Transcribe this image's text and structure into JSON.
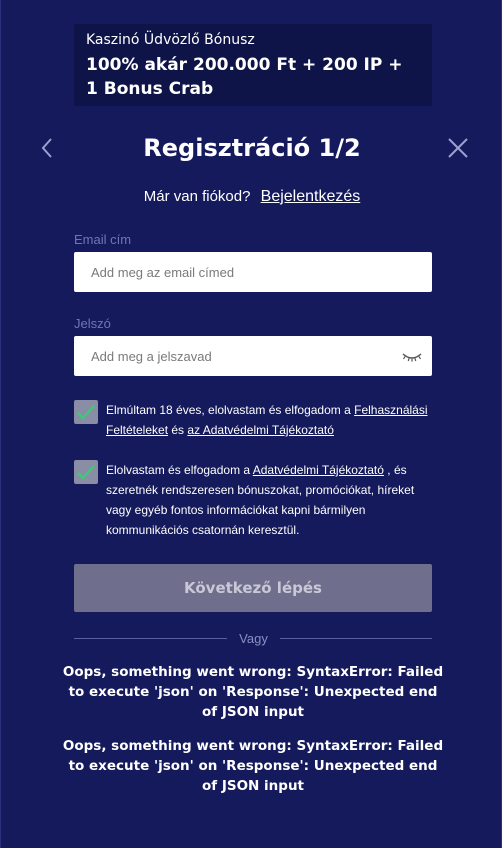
{
  "bonus": {
    "caption": "Kaszinó Üdvözlő Bónusz",
    "offer": "100% akár 200.000 Ft + 200 IP + 1 Bonus Crab"
  },
  "header": {
    "title": "Regisztráció 1/2",
    "back_icon": "chevron-left-icon",
    "close_icon": "close-icon"
  },
  "login": {
    "question": "Már van fiókod?",
    "link": "Bejelentkezés"
  },
  "email": {
    "label": "Email cím",
    "placeholder": "Add meg az email címed",
    "value": ""
  },
  "password": {
    "label": "Jelszó",
    "placeholder": "Add meg a jelszavad",
    "value": "",
    "toggle_icon": "eye-closed-icon"
  },
  "consents": [
    {
      "checked": true,
      "text_before": "Elmúltam 18 éves, elolvastam és elfogadom a ",
      "link1": "Felhasználási Feltételeket",
      "text_mid": " és ",
      "link2": "az Adatvédelmi Tájékoztató",
      "text_after": ""
    },
    {
      "checked": true,
      "text_before": "Elolvastam és elfogadom a ",
      "link1": "Adatvédelmi Tájékoztató",
      "text_after": " , és szeretnék rendszeresen bónuszokat, promóciókat, híreket vagy egyéb fontos információkat kapni bármilyen kommunikációs csatornán keresztül."
    }
  ],
  "next_button": "Következő lépés",
  "divider_label": "Vagy",
  "errors": [
    "Oops, something went wrong: SyntaxError: Failed to execute 'json' on 'Response': Unexpected end of JSON input",
    "Oops, something went wrong: SyntaxError: Failed to execute 'json' on 'Response': Unexpected end of JSON input"
  ],
  "colors": {
    "background": "#141a5b",
    "banner": "#0f1448",
    "checkbox": "#8a8da6",
    "checkmark": "#3fc87a",
    "button_disabled": "#6f6f8d",
    "label": "#6f76b6"
  }
}
